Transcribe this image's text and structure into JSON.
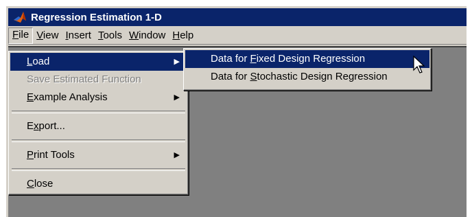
{
  "window": {
    "title": "Regression Estimation 1-D"
  },
  "menubar": [
    {
      "name": "file",
      "pre": "",
      "key": "F",
      "post": "ile"
    },
    {
      "name": "view",
      "pre": "",
      "key": "V",
      "post": "iew"
    },
    {
      "name": "insert",
      "pre": "",
      "key": "I",
      "post": "nsert"
    },
    {
      "name": "tools",
      "pre": "",
      "key": "T",
      "post": "ools"
    },
    {
      "name": "window",
      "pre": "",
      "key": "W",
      "post": "indow"
    },
    {
      "name": "help",
      "pre": "",
      "key": "H",
      "post": "elp"
    }
  ],
  "file_menu": {
    "load": {
      "pre": "",
      "key": "L",
      "post": "oad"
    },
    "save_estimated": {
      "text": "Save Estimated Function"
    },
    "example": {
      "pre": "",
      "key": "E",
      "post": "xample Analysis"
    },
    "export": {
      "pre": "E",
      "key": "x",
      "post": "port..."
    },
    "print_tools": {
      "pre": "",
      "key": "P",
      "post": "rint Tools"
    },
    "close": {
      "pre": "",
      "key": "C",
      "post": "lose"
    }
  },
  "load_submenu": {
    "fixed": {
      "pre": "Data for ",
      "key": "F",
      "post": "ixed Design Regression"
    },
    "stochastic": {
      "pre": "Data for ",
      "key": "S",
      "post": "tochastic Design Regression"
    }
  },
  "colors": {
    "highlight": "#0a246a",
    "face": "#d4d0c8",
    "workspace": "#808080"
  },
  "icons": {
    "app": "matlab-logo-icon",
    "submenu": "triangle-right-icon",
    "pointer": "mouse-pointer-icon"
  }
}
